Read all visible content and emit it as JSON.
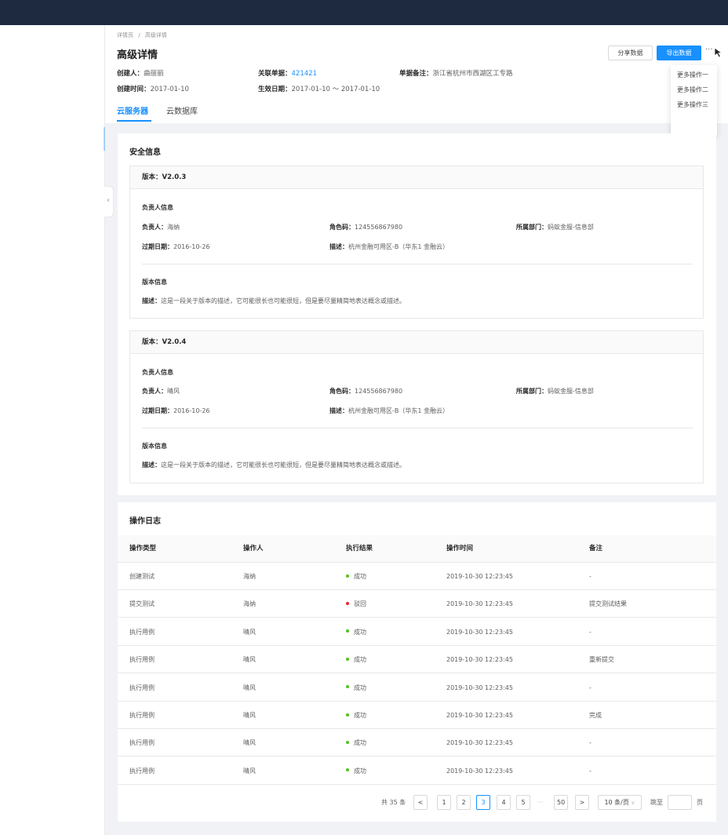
{
  "breadcrumb": [
    "详情页",
    "高级详情"
  ],
  "breadcrumb_sep": "/",
  "page_title": "高级详情",
  "header_meta": {
    "creator_label": "创建人：",
    "creator": "曲丽丽",
    "related_label": "关联单据：",
    "related": "421421",
    "note_label": "单据备注：",
    "note": "浙江省杭州市西湖区工专路",
    "created_label": "创建时间：",
    "created": "2017-01-10",
    "effective_label": "生效日期：",
    "effective": "2017-01-10 ～ 2017-01-10"
  },
  "actions": {
    "share": "分享数据",
    "export": "导出数据",
    "more": "···"
  },
  "dropdown": [
    "更多操作一",
    "更多操作二",
    "更多操作三"
  ],
  "tabs": [
    "云服务器",
    "云数据库"
  ],
  "security": {
    "title": "安全信息",
    "versions": [
      {
        "label": "版本：V2.0.3",
        "owner_section": "负责人信息",
        "owner_label": "负责人：",
        "owner": "海纳",
        "role_label": "角色码：",
        "role": "124556867980",
        "dept_label": "所属部门：",
        "dept": "蚂蚁金服-信息部",
        "expire_label": "过期日期：",
        "expire": "2016-10-26",
        "desc_label": "描述：",
        "desc": "杭州金融可用区-B（华东1 金融云）",
        "version_section": "版本信息",
        "vdesc_label": "描述：",
        "vdesc": "这是一段关于版本的描述，它可能很长也可能很短，但是要尽量精简地表达概念或描述。"
      },
      {
        "label": "版本：V2.0.4",
        "owner_section": "负责人信息",
        "owner_label": "负责人：",
        "owner": "晴风",
        "role_label": "角色码：",
        "role": "124556867980",
        "dept_label": "所属部门：",
        "dept": "蚂蚁金服-信息部",
        "expire_label": "过期日期：",
        "expire": "2016-10-26",
        "desc_label": "描述：",
        "desc": "杭州金融可用区-B（华东1 金融云）",
        "version_section": "版本信息",
        "vdesc_label": "描述：",
        "vdesc": "这是一段关于版本的描述，它可能很长也可能很短，但是要尽量精简地表达概念或描述。"
      }
    ]
  },
  "oplog": {
    "title": "操作日志",
    "columns": [
      "操作类型",
      "操作人",
      "执行结果",
      "操作时间",
      "备注"
    ],
    "rows": [
      [
        "创建测试",
        "海纳",
        "成功",
        "2019-10-30 12:23:45",
        "-"
      ],
      [
        "提交测试",
        "海纳",
        "驳回",
        "2019-10-30 12:23:45",
        "提交测试结果"
      ],
      [
        "执行用例",
        "晴风",
        "成功",
        "2019-10-30 12:23:45",
        "-"
      ],
      [
        "执行用例",
        "晴风",
        "成功",
        "2019-10-30 12:23:45",
        "重新提交"
      ],
      [
        "执行用例",
        "晴风",
        "成功",
        "2019-10-30 12:23:45",
        "-"
      ],
      [
        "执行用例",
        "晴风",
        "成功",
        "2019-10-30 12:23:45",
        "完成"
      ],
      [
        "执行用例",
        "晴风",
        "成功",
        "2019-10-30 12:23:45",
        "-"
      ],
      [
        "执行用例",
        "晴风",
        "成功",
        "2019-10-30 12:23:45",
        "-"
      ]
    ],
    "status_colors": {
      "成功": "#52c41a",
      "驳回": "#f5222d"
    }
  },
  "pagination": {
    "total": "共 35 条",
    "pages": [
      "1",
      "2",
      "3",
      "4",
      "5"
    ],
    "current": "3",
    "ellipsis": "···",
    "last": "50",
    "prev": "<",
    "next": ">",
    "size": "10 条/页",
    "jump_label": "跳至",
    "jump_suffix": "页"
  },
  "colors": {
    "accent": "#1890ff",
    "topbar": "#1d2a3f",
    "success": "#52c41a",
    "error": "#f5222d"
  },
  "icons": {
    "collapse": "chevron-left-icon",
    "cursor": "cursor-icon"
  }
}
